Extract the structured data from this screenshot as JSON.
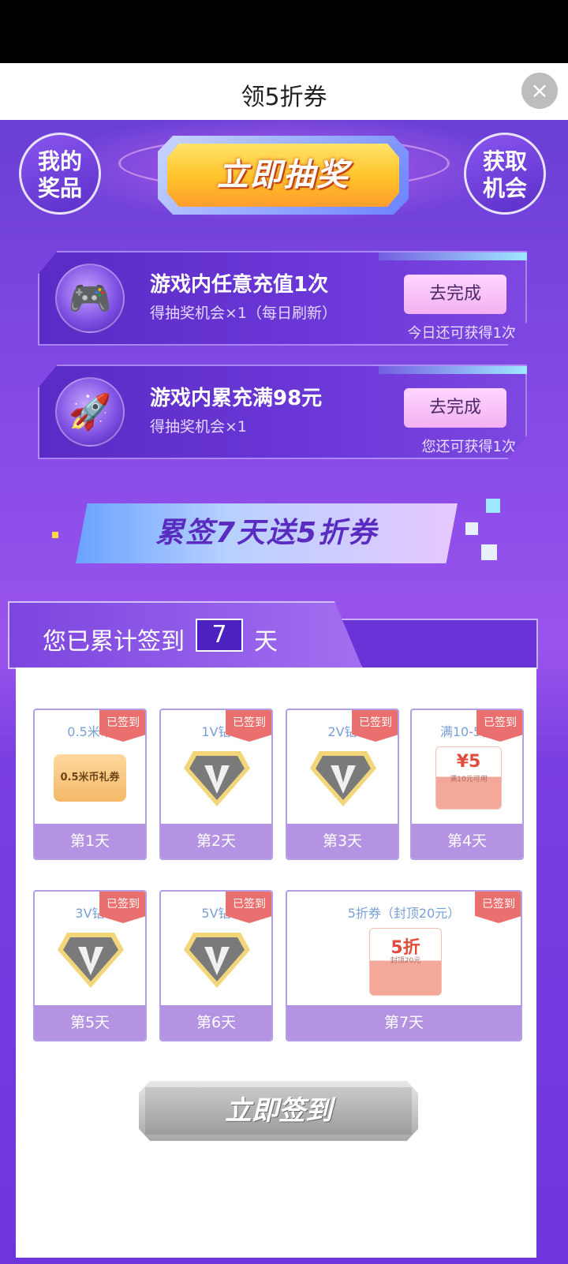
{
  "header": {
    "title": "领5折券",
    "close_icon": "×"
  },
  "top": {
    "my_prizes_line1": "我的",
    "my_prizes_line2": "奖品",
    "get_chance_line1": "获取",
    "get_chance_line2": "机会",
    "lottery_label": "立即抽奖"
  },
  "tasks": [
    {
      "icon": "gamepad-icon",
      "title": "游戏内任意充值1次",
      "subtitle": "得抽奖机会×1（每日刷新）",
      "button": "去完成",
      "note": "今日还可获得1次"
    },
    {
      "icon": "rocket-icon",
      "title": "游戏内累充满98元",
      "subtitle": "得抽奖机会×1",
      "button": "去完成",
      "note": "您还可获得1次"
    }
  ],
  "banner": {
    "text": "累签7天送5折券"
  },
  "signin": {
    "label": "您已累计签到",
    "days": "7",
    "unit": "天",
    "button_label": "立即签到",
    "signed_tag": "已签到",
    "rewards": [
      {
        "name": "0.5米币",
        "day": "第1天",
        "coupon_text": "0.5米币礼券"
      },
      {
        "name": "1V钻",
        "day": "第2天"
      },
      {
        "name": "2V钻",
        "day": "第3天"
      },
      {
        "name": "满10-5优",
        "day": "第4天",
        "amount": "¥5",
        "condition": "满10元可用"
      },
      {
        "name": "3V钻",
        "day": "第5天"
      },
      {
        "name": "5V钻",
        "day": "第6天"
      },
      {
        "name": "5折券（封顶20元）",
        "day": "第7天",
        "amount": "5折",
        "condition": "封顶20元"
      }
    ]
  },
  "colors": {
    "accent_purple": "#7d46e0",
    "signed_red": "#ea6f6f",
    "day_bar": "#b493e3"
  }
}
